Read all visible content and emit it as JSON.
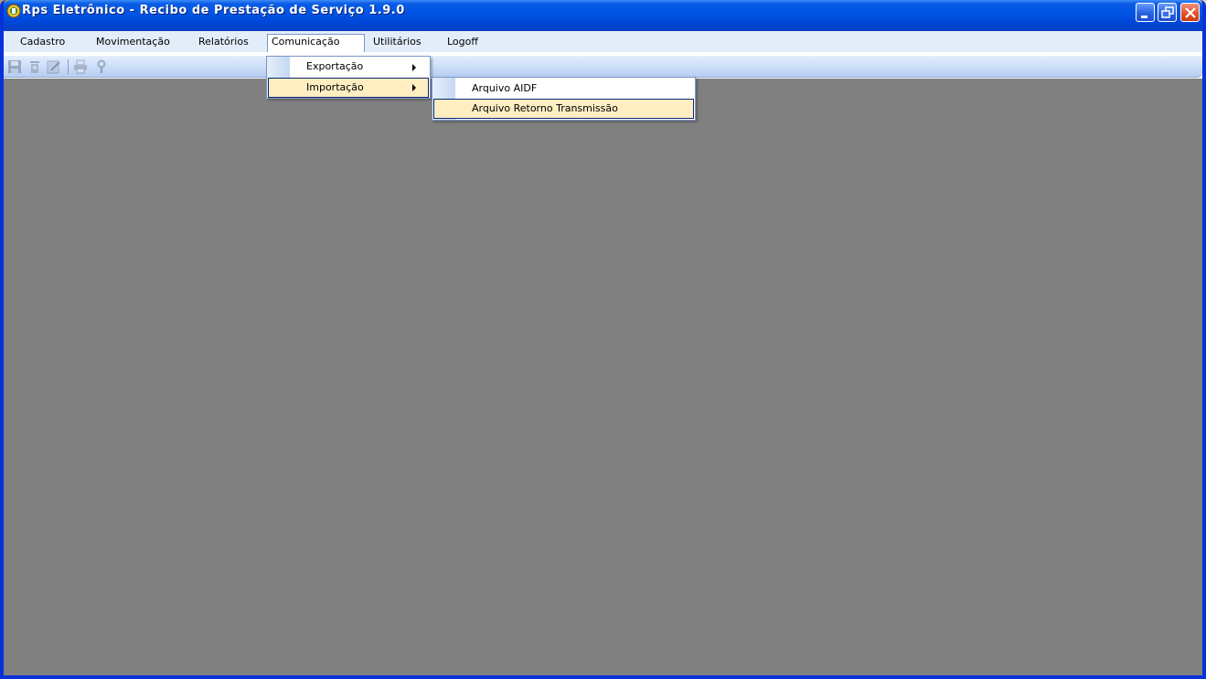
{
  "window": {
    "title": "Rps Eletrônico - Recibo de Prestação de Serviço 1.9.0"
  },
  "menubar": {
    "items": [
      {
        "label": "Cadastro"
      },
      {
        "label": "Movimentação"
      },
      {
        "label": "Relatórios"
      },
      {
        "label": "Comunicação"
      },
      {
        "label": "Utilitários"
      },
      {
        "label": "Logoff"
      }
    ],
    "open_menu": "Comunicação"
  },
  "comunicacao_menu": {
    "items": [
      {
        "label": "Exportação",
        "has_submenu": true
      },
      {
        "label": "Importação",
        "has_submenu": true,
        "highlighted": true
      }
    ]
  },
  "importacao_submenu": {
    "items": [
      {
        "label": "Arquivo AIDF"
      },
      {
        "label": "Arquivo Retorno Transmissão",
        "highlighted": true
      }
    ]
  },
  "toolbar": {
    "icons": [
      "save-icon",
      "delete-icon",
      "edit-icon",
      "print-icon",
      "help-icon"
    ]
  },
  "colors": {
    "titlebar": "#0054e3",
    "menubar": "#e3edfa",
    "client_area": "#808080",
    "menu_highlight": "#ffeec2"
  }
}
